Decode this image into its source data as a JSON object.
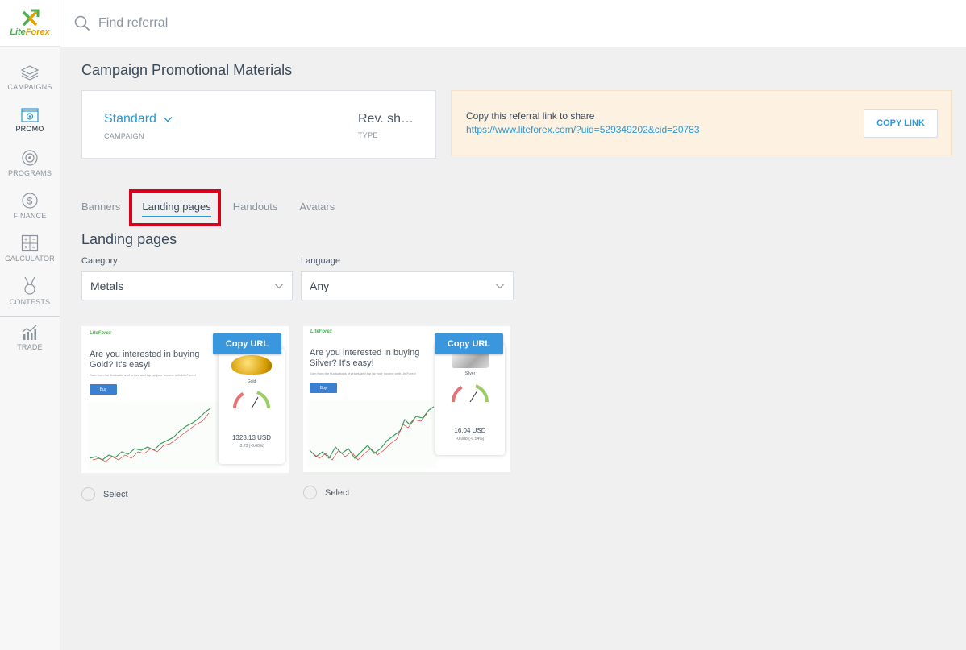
{
  "brand": {
    "name_part1": "Lite",
    "name_part2": "Forex"
  },
  "search": {
    "placeholder": "Find referral"
  },
  "sidebar": {
    "items": [
      {
        "label": "CAMPAIGNS",
        "icon": "layers-icon"
      },
      {
        "label": "PROMO",
        "icon": "promo-icon",
        "active": true
      },
      {
        "label": "PROGRAMS",
        "icon": "target-icon"
      },
      {
        "label": "FINANCE",
        "icon": "dollar-icon"
      },
      {
        "label": "CALCULATOR",
        "icon": "calculator-icon"
      },
      {
        "label": "CONTESTS",
        "icon": "medal-icon"
      },
      {
        "label": "TRADE",
        "icon": "chart-icon"
      }
    ]
  },
  "page": {
    "title": "Campaign Promotional Materials"
  },
  "campaign": {
    "value": "Standard",
    "label": "CAMPAIGN",
    "type_value": "Rev. sh…",
    "type_label": "TYPE"
  },
  "referral": {
    "text": "Copy this referral link to share",
    "url": "https://www.liteforex.com/?uid=529349202&cid=20783",
    "button": "COPY LINK"
  },
  "tabs": [
    {
      "label": "Banners"
    },
    {
      "label": "Landing pages",
      "active": true
    },
    {
      "label": "Handouts"
    },
    {
      "label": "Avatars"
    }
  ],
  "section": {
    "title": "Landing pages"
  },
  "filters": {
    "category": {
      "label": "Category",
      "value": "Metals"
    },
    "language": {
      "label": "Language",
      "value": "Any"
    }
  },
  "landing_pages": [
    {
      "copy_label": "Copy URL",
      "headline_1": "Are you interested in buying",
      "headline_2": "Gold? It's easy!",
      "sub": "Earn from the fluctuations of prices and top up your income with LiteForex!",
      "buy": "Buy",
      "metal": "Gold",
      "price": "1323.13 USD",
      "change": "-3.73 (-0.00%)",
      "select_label": "Select"
    },
    {
      "copy_label": "Copy URL",
      "headline_1": "Are you interested in buying",
      "headline_2": "Silver? It's easy!",
      "sub": "Earn from the fluctuations of prices and top up your income with LiteForex!",
      "buy": "Buy",
      "metal": "Silver",
      "price": "16.04 USD",
      "change": "-0.088 (-0.54%)",
      "select_label": "Select"
    }
  ],
  "colors": {
    "accent": "#2a9ad6",
    "highlight": "#d9001b",
    "referral_bg": "#fdf1e1"
  }
}
